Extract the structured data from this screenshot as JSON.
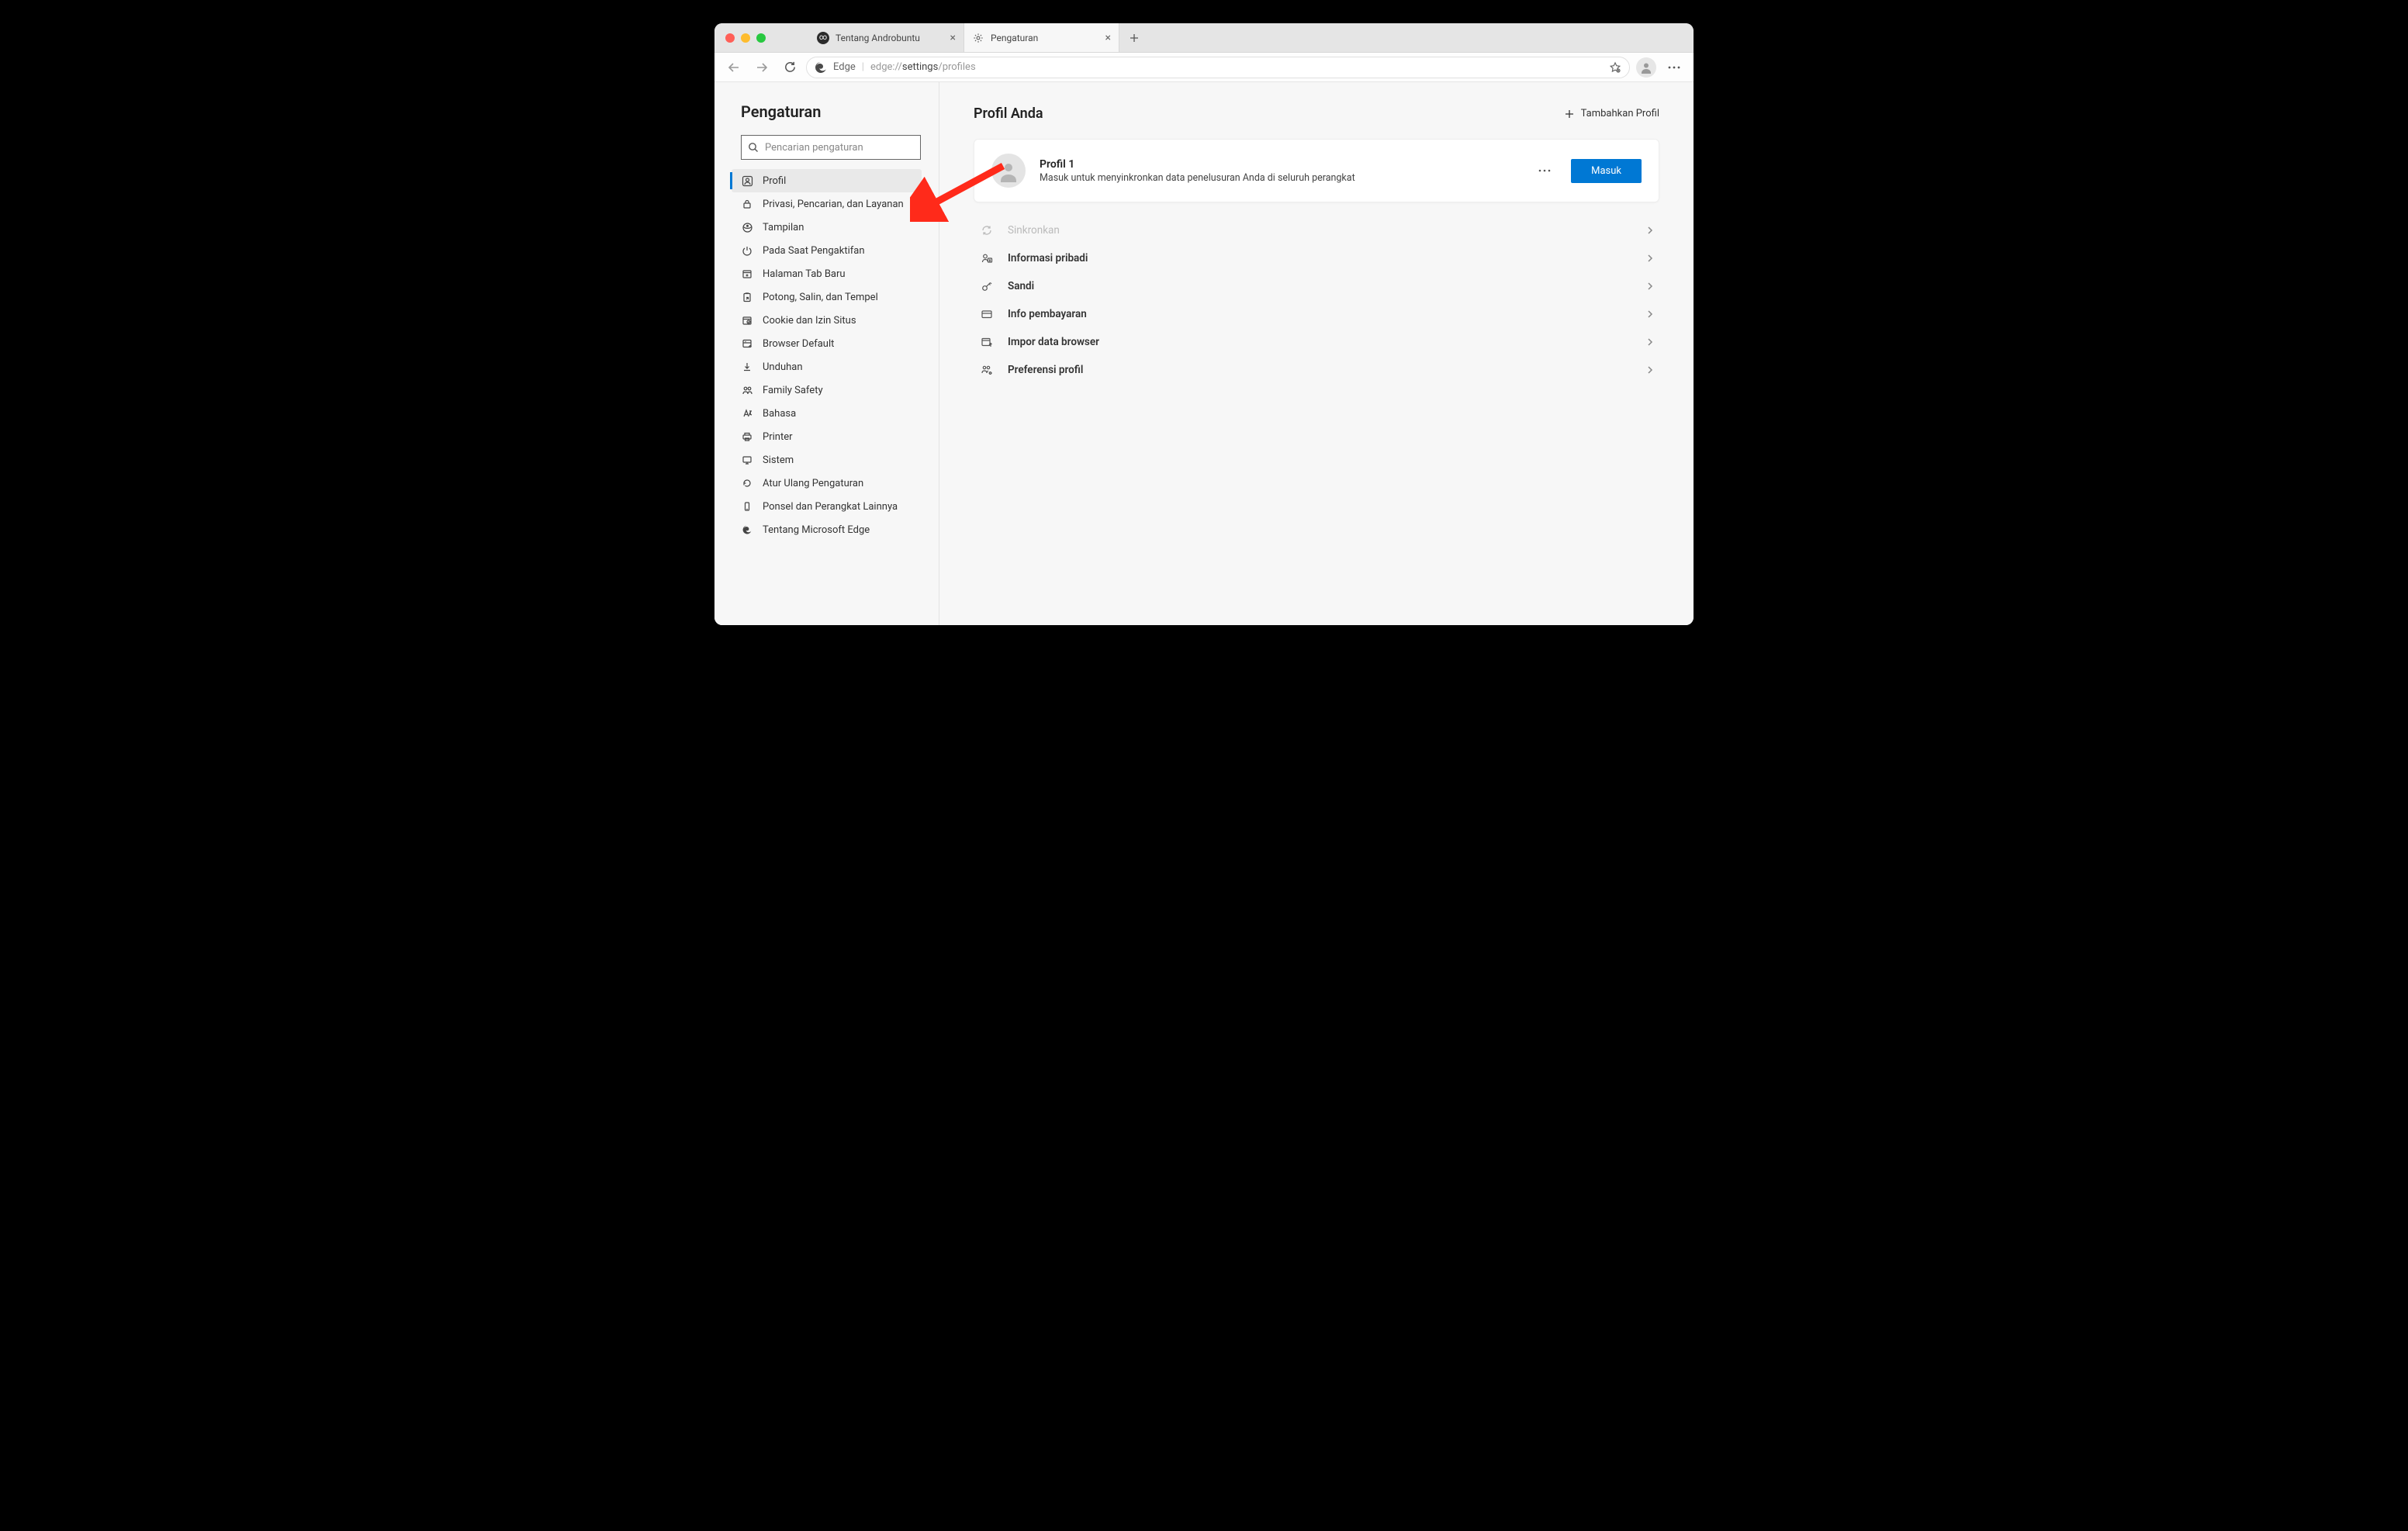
{
  "tabs": {
    "tab1_label": "Tentang Androbuntu",
    "tab2_label": "Pengaturan"
  },
  "toolbar": {
    "address_prefix": "Edge",
    "url_proto": "edge://",
    "url_bold": "settings",
    "url_rest": "/profiles"
  },
  "sidebar": {
    "title": "Pengaturan",
    "search_placeholder": "Pencarian pengaturan",
    "items": [
      "Profil",
      "Privasi, Pencarian, dan Layanan",
      "Tampilan",
      "Pada Saat Pengaktifan",
      "Halaman Tab Baru",
      "Potong, Salin, dan Tempel",
      "Cookie dan Izin Situs",
      "Browser Default",
      "Unduhan",
      "Family Safety",
      "Bahasa",
      "Printer",
      "Sistem",
      "Atur Ulang Pengaturan",
      "Ponsel dan Perangkat Lainnya",
      "Tentang Microsoft Edge"
    ]
  },
  "main": {
    "title": "Profil Anda",
    "add_profile": "Tambahkan Profil",
    "profile_name": "Profil 1",
    "profile_sub": "Masuk untuk menyinkronkan data penelusuran Anda di seluruh perangkat",
    "signin_label": "Masuk",
    "items": [
      "Sinkronkan",
      "Informasi pribadi",
      "Sandi",
      "Info pembayaran",
      "Impor data browser",
      "Preferensi profil"
    ]
  }
}
